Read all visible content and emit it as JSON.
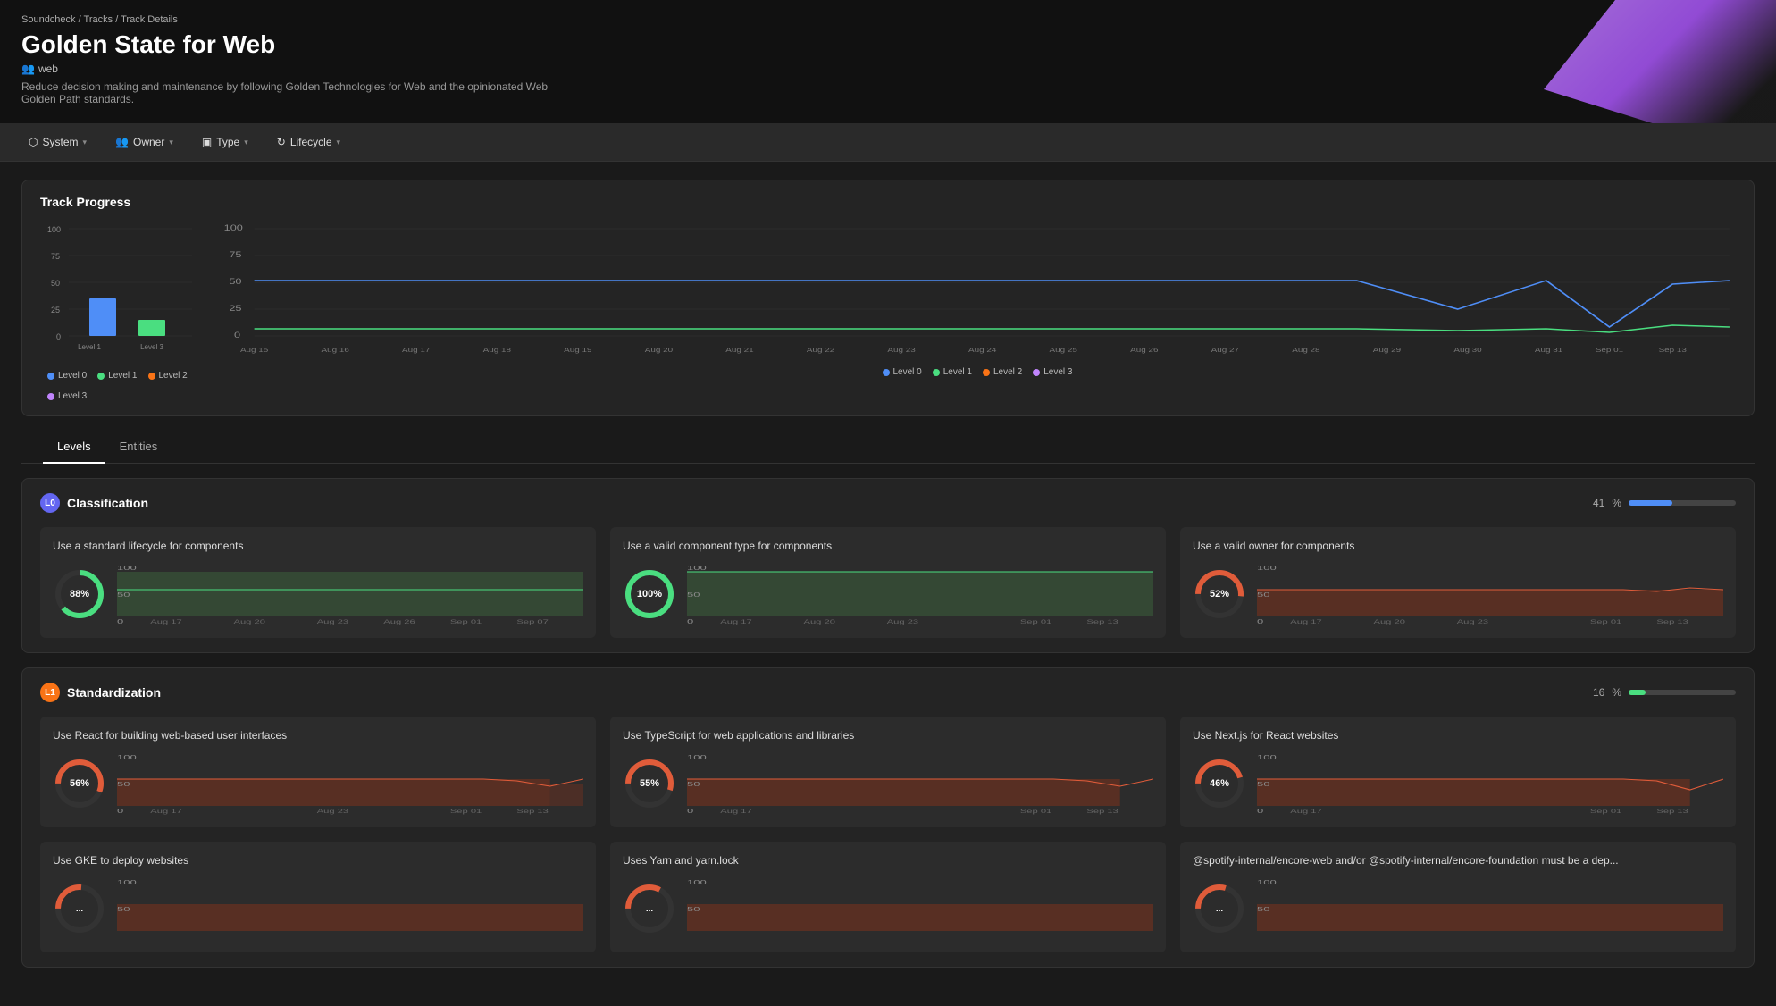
{
  "breadcrumb": {
    "root": "Soundcheck",
    "parent": "Tracks",
    "current": "Track Details"
  },
  "header": {
    "title": "Golden State for Web",
    "owner": "web",
    "description": "Reduce decision making and maintenance by following Golden Technologies for Web and the opinionated Web Golden Path standards."
  },
  "filters": [
    {
      "label": "System",
      "icon": "⬡"
    },
    {
      "label": "Owner",
      "icon": "👥"
    },
    {
      "label": "Type",
      "icon": "▣"
    },
    {
      "label": "Lifecycle",
      "icon": "↻"
    }
  ],
  "trackProgress": {
    "title": "Track Progress",
    "barChart": {
      "yMax": 100,
      "bars": [
        {
          "label": "Level 1",
          "value": 35,
          "color": "#4f8ef7"
        },
        {
          "label": "Level 3",
          "value": 15,
          "color": "#4ade80"
        }
      ],
      "extraLabels": [
        {
          "label": "Level 0",
          "color": "#4f8ef7"
        },
        {
          "label": "Level 1",
          "color": "#4ade80"
        },
        {
          "label": "Level 2",
          "color": "#f97316"
        },
        {
          "label": "Level 3",
          "color": "#c084fc"
        }
      ]
    },
    "lineChart": {
      "legend": [
        {
          "label": "Level 0",
          "color": "#4f8ef7"
        },
        {
          "label": "Level 1",
          "color": "#4ade80"
        },
        {
          "label": "Level 2",
          "color": "#f97316"
        },
        {
          "label": "Level 3",
          "color": "#c084fc"
        }
      ]
    }
  },
  "tabs": [
    "Levels",
    "Entities"
  ],
  "activeTab": "Levels",
  "classification": {
    "title": "Classification",
    "badgeLevel": "L0",
    "badgeClass": "l0",
    "pct": 41,
    "pctColor": "#4f8ef7",
    "metrics": [
      {
        "title": "Use a standard lifecycle for components",
        "pct": 88,
        "pctLabel": "88%",
        "color": "#4ade80",
        "chartType": "line-green"
      },
      {
        "title": "Use a valid component type for components",
        "pct": 100,
        "pctLabel": "100%",
        "color": "#4ade80",
        "chartType": "line-green"
      },
      {
        "title": "Use a valid owner for components",
        "pct": 52,
        "pctLabel": "52%",
        "color": "#e05c3a",
        "chartType": "line-orange"
      }
    ]
  },
  "standardization": {
    "title": "Standardization",
    "badgeLevel": "L1",
    "badgeClass": "l1",
    "pct": 16,
    "pctColor": "#4ade80",
    "metrics": [
      {
        "title": "Use React for building web-based user interfaces",
        "pct": 56,
        "pctLabel": "56%",
        "color": "#e05c3a",
        "chartType": "line-orange"
      },
      {
        "title": "Use TypeScript for web applications and libraries",
        "pct": 55,
        "pctLabel": "55%",
        "color": "#e05c3a",
        "chartType": "line-orange"
      },
      {
        "title": "Use Next.js for React websites",
        "pct": 46,
        "pctLabel": "46%",
        "color": "#e05c3a",
        "chartType": "line-orange"
      }
    ]
  },
  "bottomMetrics": [
    {
      "title": "Use GKE to deploy websites",
      "pct": 0,
      "pctLabel": "...",
      "color": "#e05c3a"
    },
    {
      "title": "Uses Yarn and yarn.lock",
      "pct": 0,
      "pctLabel": "...",
      "color": "#e05c3a"
    },
    {
      "title": "@spotify-internal/encore-web and/or @spotify-internal/encore-foundation must be a dep...",
      "pct": 0,
      "pctLabel": "...",
      "color": "#e05c3a"
    }
  ]
}
